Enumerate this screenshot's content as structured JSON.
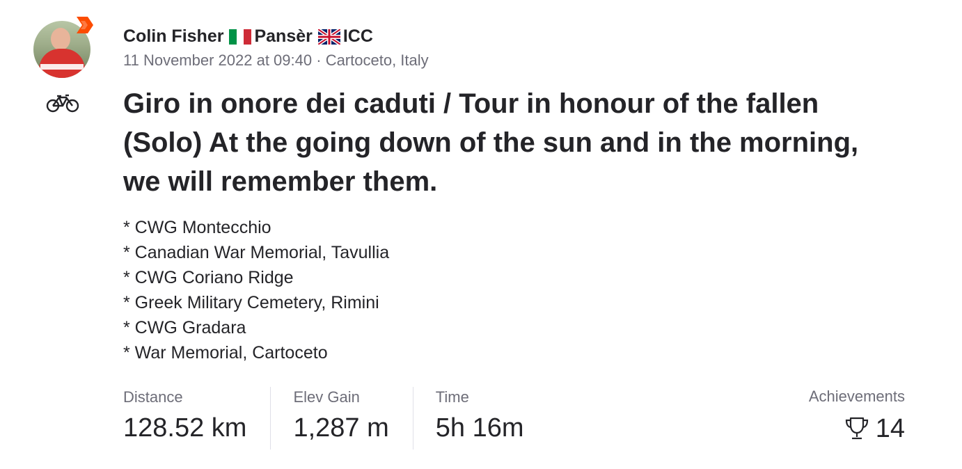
{
  "athlete": {
    "name": "Colin Fisher",
    "club_it": "Pansèr",
    "club_uk": "ICC"
  },
  "activity": {
    "date": "11 November 2022 at 09:40",
    "separator": " · ",
    "location": "Cartoceto, Italy",
    "sport_icon": "bicycle-icon",
    "title": "Giro in onore dei caduti / Tour in honour of the fallen (Solo) At the going down of the sun and in the morning, we will remember them.",
    "description": [
      "* CWG Montecchio",
      "* Canadian War Memorial, Tavullia",
      "* CWG Coriano Ridge",
      "* Greek Military Cemetery, Rimini",
      "* CWG Gradara",
      "* War Memorial, Cartoceto"
    ]
  },
  "stats": [
    {
      "label": "Distance",
      "value": "128.52 km"
    },
    {
      "label": "Elev Gain",
      "value": "1,287 m"
    },
    {
      "label": "Time",
      "value": "5h 16m"
    }
  ],
  "achievements": {
    "label": "Achievements",
    "count": "14",
    "icon": "trophy-icon"
  },
  "colors": {
    "text": "#242428",
    "muted": "#6d6d78",
    "brand": "#fc4c02",
    "divider": "#dfdfe8"
  }
}
